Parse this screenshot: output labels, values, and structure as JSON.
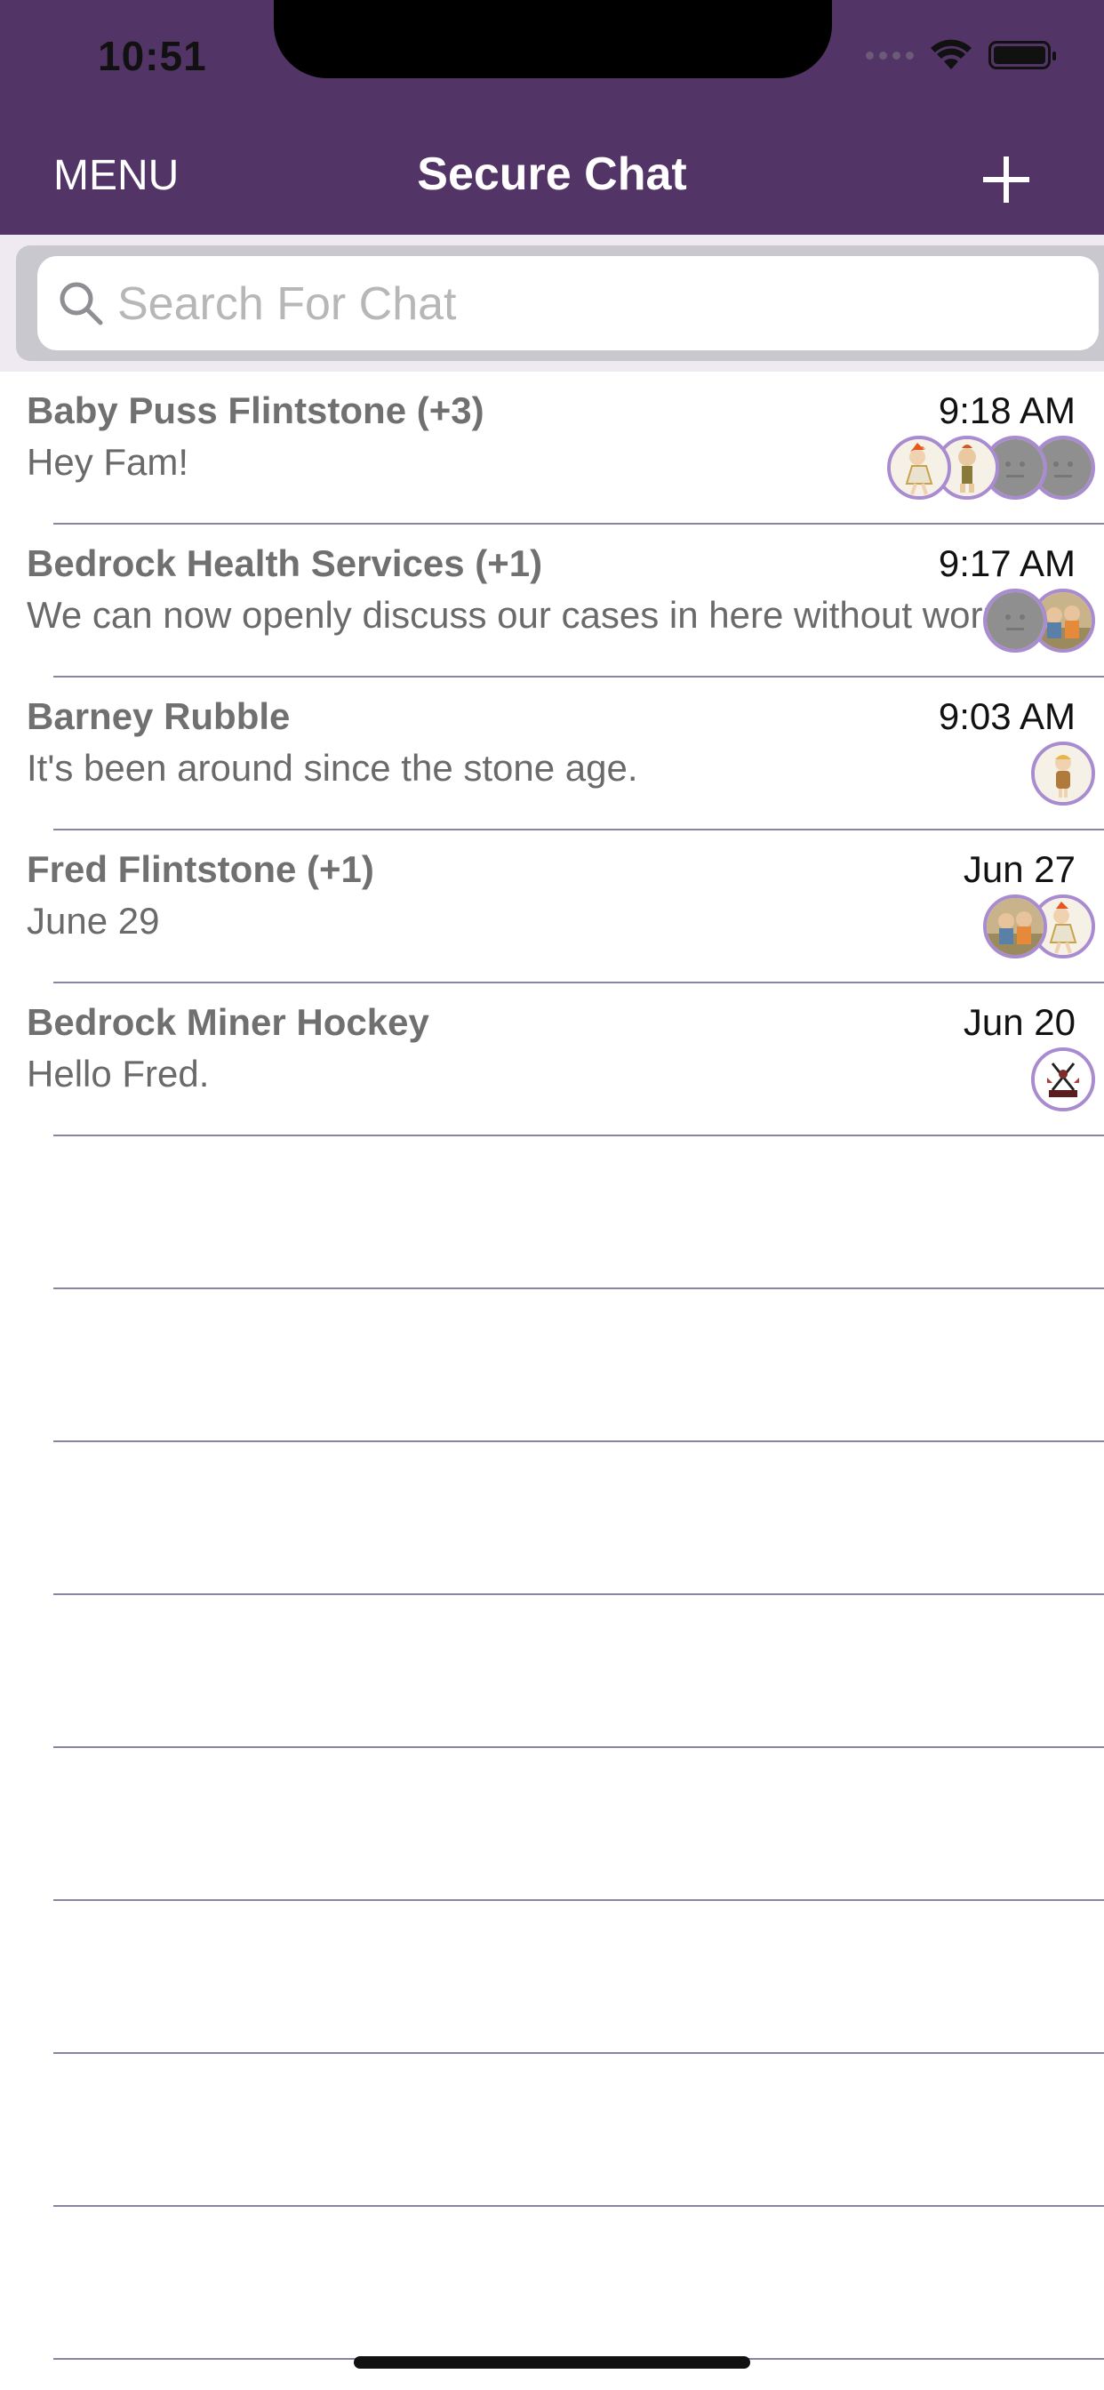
{
  "status_bar": {
    "time": "10:51"
  },
  "header": {
    "menu_label": "MENU",
    "title": "Secure Chat",
    "add_icon": "plus-icon"
  },
  "search": {
    "placeholder": "Search For Chat",
    "value": "",
    "icon": "search-icon"
  },
  "chats": [
    {
      "title": "Baby Puss Flintstone (+3)",
      "preview": "Hey Fam!",
      "time": "9:18 AM",
      "avatars": [
        "pebbles",
        "bamm-bamm",
        "default",
        "default"
      ]
    },
    {
      "title": "Bedrock Health Services (+1)",
      "preview": "We can now openly discuss our cases in here without worry.",
      "time": "9:17 AM",
      "avatars": [
        "default",
        "family"
      ]
    },
    {
      "title": "Barney Rubble",
      "preview": "It's been around since the stone age.",
      "time": "9:03 AM",
      "avatars": [
        "barney"
      ]
    },
    {
      "title": "Fred Flintstone (+1)",
      "preview": "June 29",
      "time": "Jun 27",
      "avatars": [
        "family",
        "pebbles"
      ]
    },
    {
      "title": "Bedrock Miner Hockey",
      "preview": "Hello Fred.",
      "time": "Jun 20",
      "avatars": [
        "hockey"
      ]
    }
  ],
  "colors": {
    "header": "#523566",
    "avatar_ring": "#a98ccf",
    "separator": "#8a84a0"
  }
}
